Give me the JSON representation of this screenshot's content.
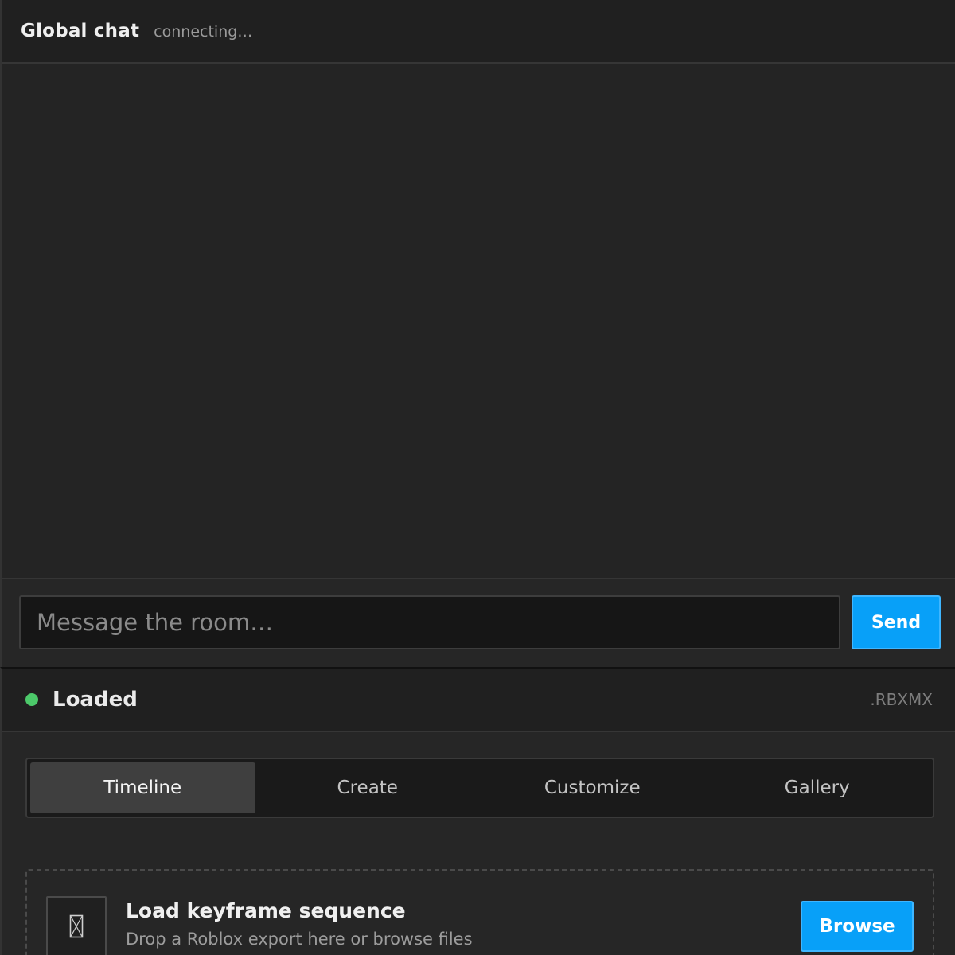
{
  "chat": {
    "title": "Global chat",
    "status": "connecting…",
    "input_placeholder": "Message the room…",
    "send_label": "Send"
  },
  "loader": {
    "status_text": "Loaded",
    "status_color": "#4cc96a",
    "format": ".RBXMX",
    "tabs": [
      {
        "label": "Timeline",
        "active": true
      },
      {
        "label": "Create",
        "active": false
      },
      {
        "label": "Customize",
        "active": false
      },
      {
        "label": "Gallery",
        "active": false
      }
    ],
    "dropzone": {
      "icon": "file-icon",
      "title": "Load keyframe sequence",
      "subtitle": "Drop a Roblox export here or browse files",
      "browse_label": "Browse"
    }
  },
  "colors": {
    "accent": "#08a0f8",
    "background": "#242424"
  }
}
